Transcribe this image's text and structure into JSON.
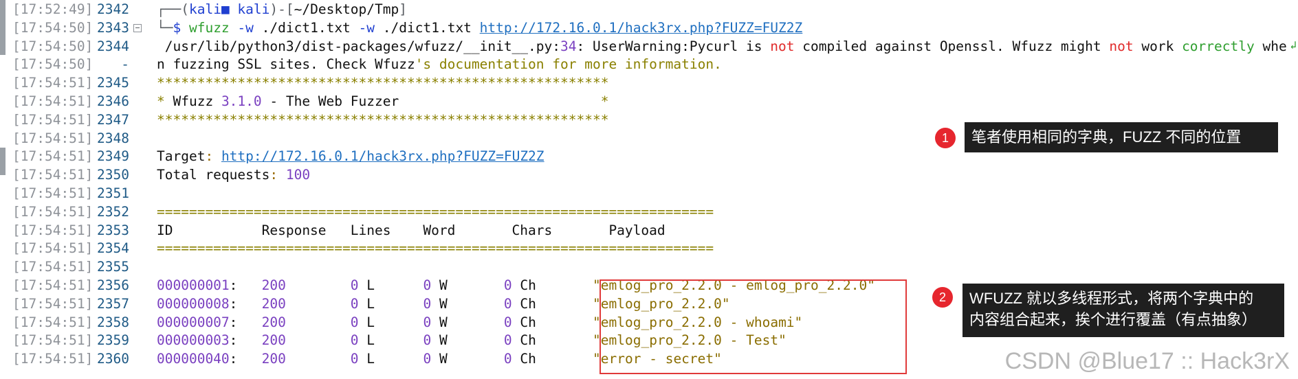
{
  "lines": [
    {
      "ts": "[17:52:49]",
      "num": "2342",
      "parts": [
        [
          "c-dim",
          "┌──("
        ],
        [
          "c-blue",
          "kali"
        ],
        [
          "c-blue",
          "■ "
        ],
        [
          "c-blue",
          "kali"
        ],
        [
          "c-dim",
          ")-["
        ],
        [
          "c-path",
          "~/Desktop/Tmp"
        ],
        [
          "c-dim",
          "]"
        ]
      ]
    },
    {
      "ts": "[17:54:50]",
      "num": "2343",
      "fold": true,
      "parts": [
        [
          "c-dim",
          "└─"
        ],
        [
          "c-blue",
          "$ "
        ],
        [
          "c-green",
          "wfuzz "
        ],
        [
          "c-blue",
          "-w "
        ],
        [
          "c-path",
          "./dict1.txt "
        ],
        [
          "c-blue",
          "-w "
        ],
        [
          "c-path",
          "./dict1.txt "
        ],
        [
          "c-link",
          "http://172.16.0.1/hack3rx.php?FUZZ=FUZ2Z"
        ]
      ]
    },
    {
      "ts": "[17:54:50]",
      "num": "2344",
      "parts": [
        [
          "c-path",
          " /usr/lib/python3/dist-packages/wfuzz/__init__.py"
        ],
        [
          "c-path",
          ":"
        ],
        [
          "c-num",
          "34"
        ],
        [
          "c-path",
          ": UserWarning:Pycurl is "
        ],
        [
          "c-red",
          "not"
        ],
        [
          "c-path",
          " compiled against Openssl. Wfuzz might "
        ],
        [
          "c-red",
          "not"
        ],
        [
          "c-path",
          " work "
        ],
        [
          "c-green",
          "correctly"
        ],
        [
          "c-path",
          " whe"
        ]
      ]
    },
    {
      "ts": "[17:54:50]",
      "num": "-",
      "parts": [
        [
          "c-path",
          "n fuzzing SSL sites. Check Wfuzz"
        ],
        [
          "c-olive",
          "'s documentation for more information."
        ]
      ]
    },
    {
      "ts": "[17:54:51]",
      "num": "2345",
      "parts": [
        [
          "c-olive",
          "********************************************************"
        ]
      ]
    },
    {
      "ts": "[17:54:51]",
      "num": "2346",
      "parts": [
        [
          "c-olive",
          "* "
        ],
        [
          "c-path",
          "Wfuzz "
        ],
        [
          "c-num",
          "3.1.0"
        ],
        [
          "c-path",
          " - The Web Fuzzer                         "
        ],
        [
          "c-olive",
          "*"
        ]
      ]
    },
    {
      "ts": "[17:54:51]",
      "num": "2347",
      "parts": [
        [
          "c-olive",
          "********************************************************"
        ]
      ]
    },
    {
      "ts": "[17:54:51]",
      "num": "2348",
      "parts": []
    },
    {
      "ts": "[17:54:51]",
      "num": "2349",
      "parts": [
        [
          "c-path",
          "Target"
        ],
        [
          "c-brown",
          ": "
        ],
        [
          "c-link",
          "http://172.16.0.1/hack3rx.php?FUZZ=FUZ2Z"
        ]
      ]
    },
    {
      "ts": "[17:54:51]",
      "num": "2350",
      "parts": [
        [
          "c-path",
          "Total requests"
        ],
        [
          "c-brown",
          ": "
        ],
        [
          "c-num",
          "100"
        ]
      ]
    },
    {
      "ts": "[17:54:51]",
      "num": "2351",
      "parts": []
    },
    {
      "ts": "[17:54:51]",
      "num": "2352",
      "parts": [
        [
          "c-olive",
          "====================================================================="
        ]
      ]
    },
    {
      "ts": "[17:54:51]",
      "num": "2353",
      "parts": [
        [
          "c-path",
          "ID           Response   Lines    Word       Chars       Payload"
        ]
      ]
    },
    {
      "ts": "[17:54:51]",
      "num": "2354",
      "parts": [
        [
          "c-olive",
          "====================================================================="
        ]
      ]
    },
    {
      "ts": "[17:54:51]",
      "num": "2355",
      "parts": []
    },
    {
      "ts": "[17:54:51]",
      "num": "2356",
      "parts": [
        [
          "c-num",
          "000000001"
        ],
        [
          "c-path",
          ":   "
        ],
        [
          "c-num",
          "200"
        ],
        [
          "c-path",
          "        "
        ],
        [
          "c-num",
          "0"
        ],
        [
          "c-path",
          " L      "
        ],
        [
          "c-num",
          "0"
        ],
        [
          "c-path",
          " W       "
        ],
        [
          "c-num",
          "0"
        ],
        [
          "c-path",
          " Ch       "
        ],
        [
          "c-str",
          "\"emlog_pro_2.2.0 - emlog_pro_2.2.0\""
        ]
      ]
    },
    {
      "ts": "[17:54:51]",
      "num": "2357",
      "parts": [
        [
          "c-num",
          "000000008"
        ],
        [
          "c-path",
          ":   "
        ],
        [
          "c-num",
          "200"
        ],
        [
          "c-path",
          "        "
        ],
        [
          "c-num",
          "0"
        ],
        [
          "c-path",
          " L      "
        ],
        [
          "c-num",
          "0"
        ],
        [
          "c-path",
          " W       "
        ],
        [
          "c-num",
          "0"
        ],
        [
          "c-path",
          " Ch       "
        ],
        [
          "c-str",
          "\"emlog_pro_2.2.0\""
        ]
      ]
    },
    {
      "ts": "[17:54:51]",
      "num": "2358",
      "parts": [
        [
          "c-num",
          "000000007"
        ],
        [
          "c-path",
          ":   "
        ],
        [
          "c-num",
          "200"
        ],
        [
          "c-path",
          "        "
        ],
        [
          "c-num",
          "0"
        ],
        [
          "c-path",
          " L      "
        ],
        [
          "c-num",
          "0"
        ],
        [
          "c-path",
          " W       "
        ],
        [
          "c-num",
          "0"
        ],
        [
          "c-path",
          " Ch       "
        ],
        [
          "c-str",
          "\"emlog_pro_2.2.0 - whoami\""
        ]
      ]
    },
    {
      "ts": "[17:54:51]",
      "num": "2359",
      "parts": [
        [
          "c-num",
          "000000003"
        ],
        [
          "c-path",
          ":   "
        ],
        [
          "c-num",
          "200"
        ],
        [
          "c-path",
          "        "
        ],
        [
          "c-num",
          "0"
        ],
        [
          "c-path",
          " L      "
        ],
        [
          "c-num",
          "0"
        ],
        [
          "c-path",
          " W       "
        ],
        [
          "c-num",
          "0"
        ],
        [
          "c-path",
          " Ch       "
        ],
        [
          "c-str",
          "\"emlog_pro_2.2.0 - Test\""
        ]
      ]
    },
    {
      "ts": "[17:54:51]",
      "num": "2360",
      "parts": [
        [
          "c-num",
          "000000040"
        ],
        [
          "c-path",
          ":   "
        ],
        [
          "c-num",
          "200"
        ],
        [
          "c-path",
          "        "
        ],
        [
          "c-num",
          "0"
        ],
        [
          "c-path",
          " L      "
        ],
        [
          "c-num",
          "0"
        ],
        [
          "c-path",
          " W       "
        ],
        [
          "c-num",
          "0"
        ],
        [
          "c-path",
          " Ch       "
        ],
        [
          "c-str",
          "\"error - secret\""
        ]
      ]
    }
  ],
  "annotations": [
    {
      "badge": "1",
      "text": "笔者使用相同的字典，FUZZ 不同的位置"
    },
    {
      "badge": "2",
      "text": "WFUZZ 就以多线程形式，将两个字典中的\n内容组合起来，挨个进行覆盖（有点抽象）"
    }
  ],
  "watermark": "CSDN @Blue17 :: Hack3rX",
  "colors": {
    "badge": "#e6262e",
    "box": "#e03a3a",
    "annotation_bg": "#1f1f1f"
  }
}
